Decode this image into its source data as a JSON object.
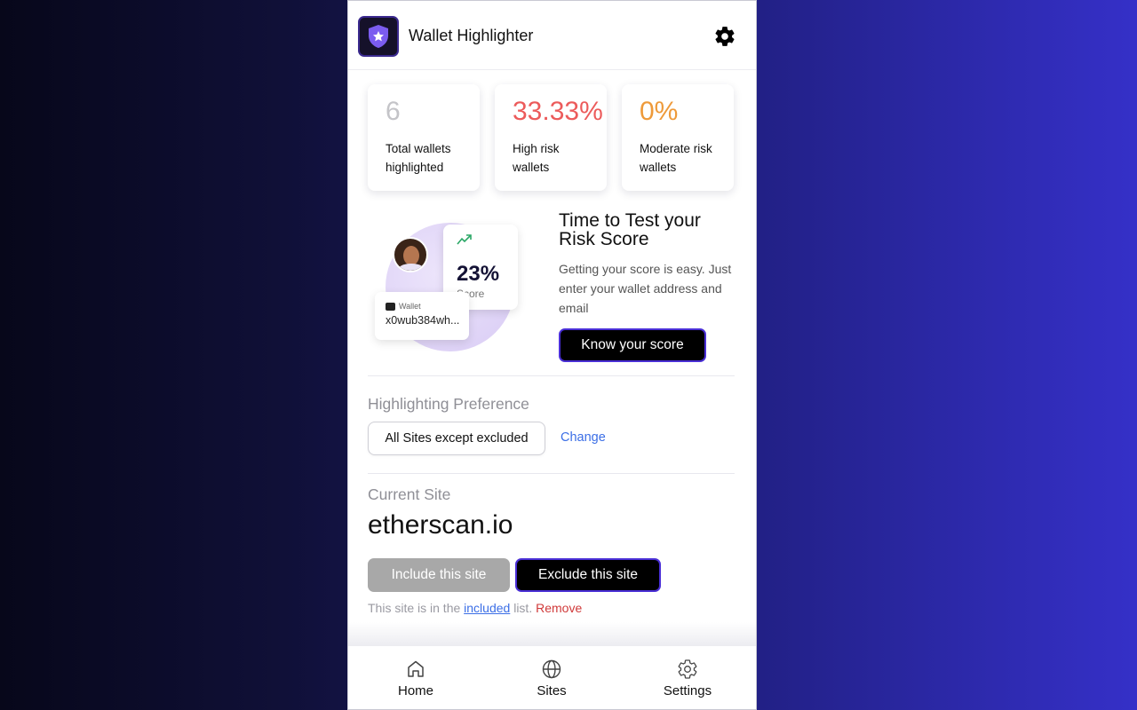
{
  "header": {
    "title": "Wallet Highlighter",
    "logo_icon": "shield-star-icon",
    "settings_icon": "gear-icon"
  },
  "stats": [
    {
      "value": "6",
      "label": "Total wallets highlighted",
      "color": "#c4c4c8"
    },
    {
      "value": "33.33%",
      "label": "High risk wallets",
      "color": "#ec5b5b"
    },
    {
      "value": "0%",
      "label": "Moderate risk wallets",
      "color": "#ee9a3a"
    }
  ],
  "promo": {
    "title": "Time to Test your Risk Score",
    "text": "Getting your score is easy. Just enter your wallet address and email",
    "button": "Know your score",
    "illustration": {
      "score": "23%",
      "score_label": "Score",
      "wallet_label": "Wallet",
      "wallet_address": "x0wub384wh..."
    }
  },
  "preference": {
    "label": "Highlighting Preference",
    "value": "All Sites except excluded",
    "change": "Change"
  },
  "current_site": {
    "label": "Current Site",
    "name": "etherscan.io",
    "include_button": "Include this site",
    "exclude_button": "Exclude this site",
    "status_prefix": "This site is in the",
    "status_link": "included",
    "status_suffix": "list.",
    "remove": "Remove"
  },
  "nav": [
    {
      "label": "Home",
      "icon": "home-icon"
    },
    {
      "label": "Sites",
      "icon": "globe-icon"
    },
    {
      "label": "Settings",
      "icon": "gear-icon"
    }
  ],
  "colors": {
    "accent": "#4a2fd6",
    "link": "#3b6ee6",
    "danger": "#d03a3a"
  }
}
